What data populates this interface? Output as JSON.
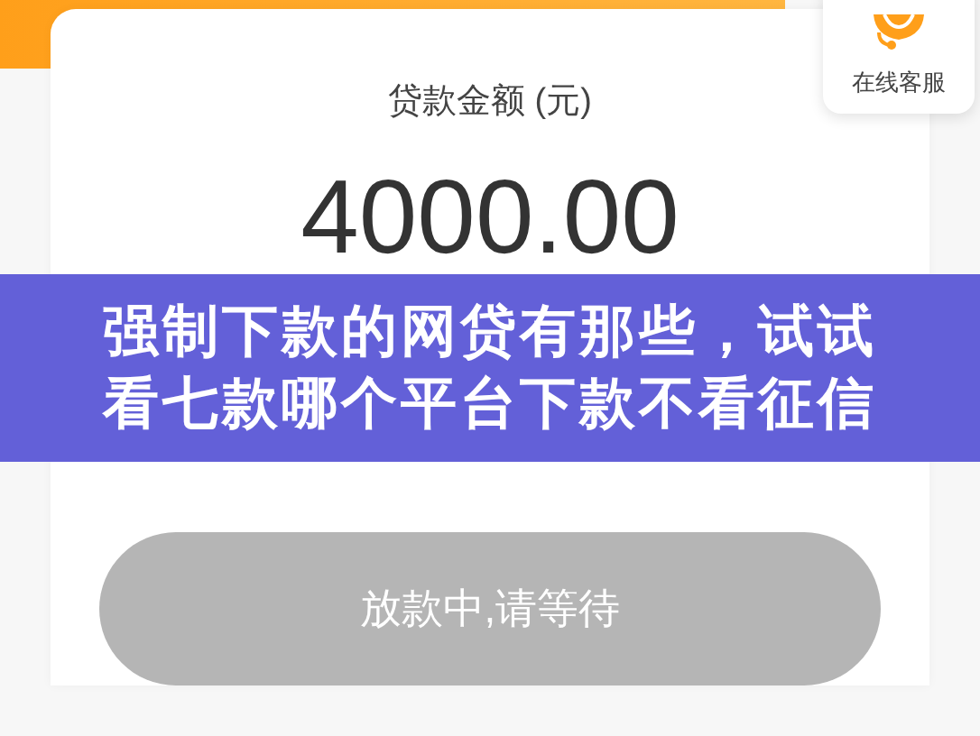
{
  "customer_service": {
    "label": "在线客服"
  },
  "loan": {
    "label": "贷款金额 (元)",
    "amount": "4000.00"
  },
  "overlay_title": {
    "lines": [
      "强制下款的网贷有那些，试试",
      "看七款哪个平台下款不看征信"
    ]
  },
  "button": {
    "label": "放款中,请等待",
    "disabled": true
  }
}
